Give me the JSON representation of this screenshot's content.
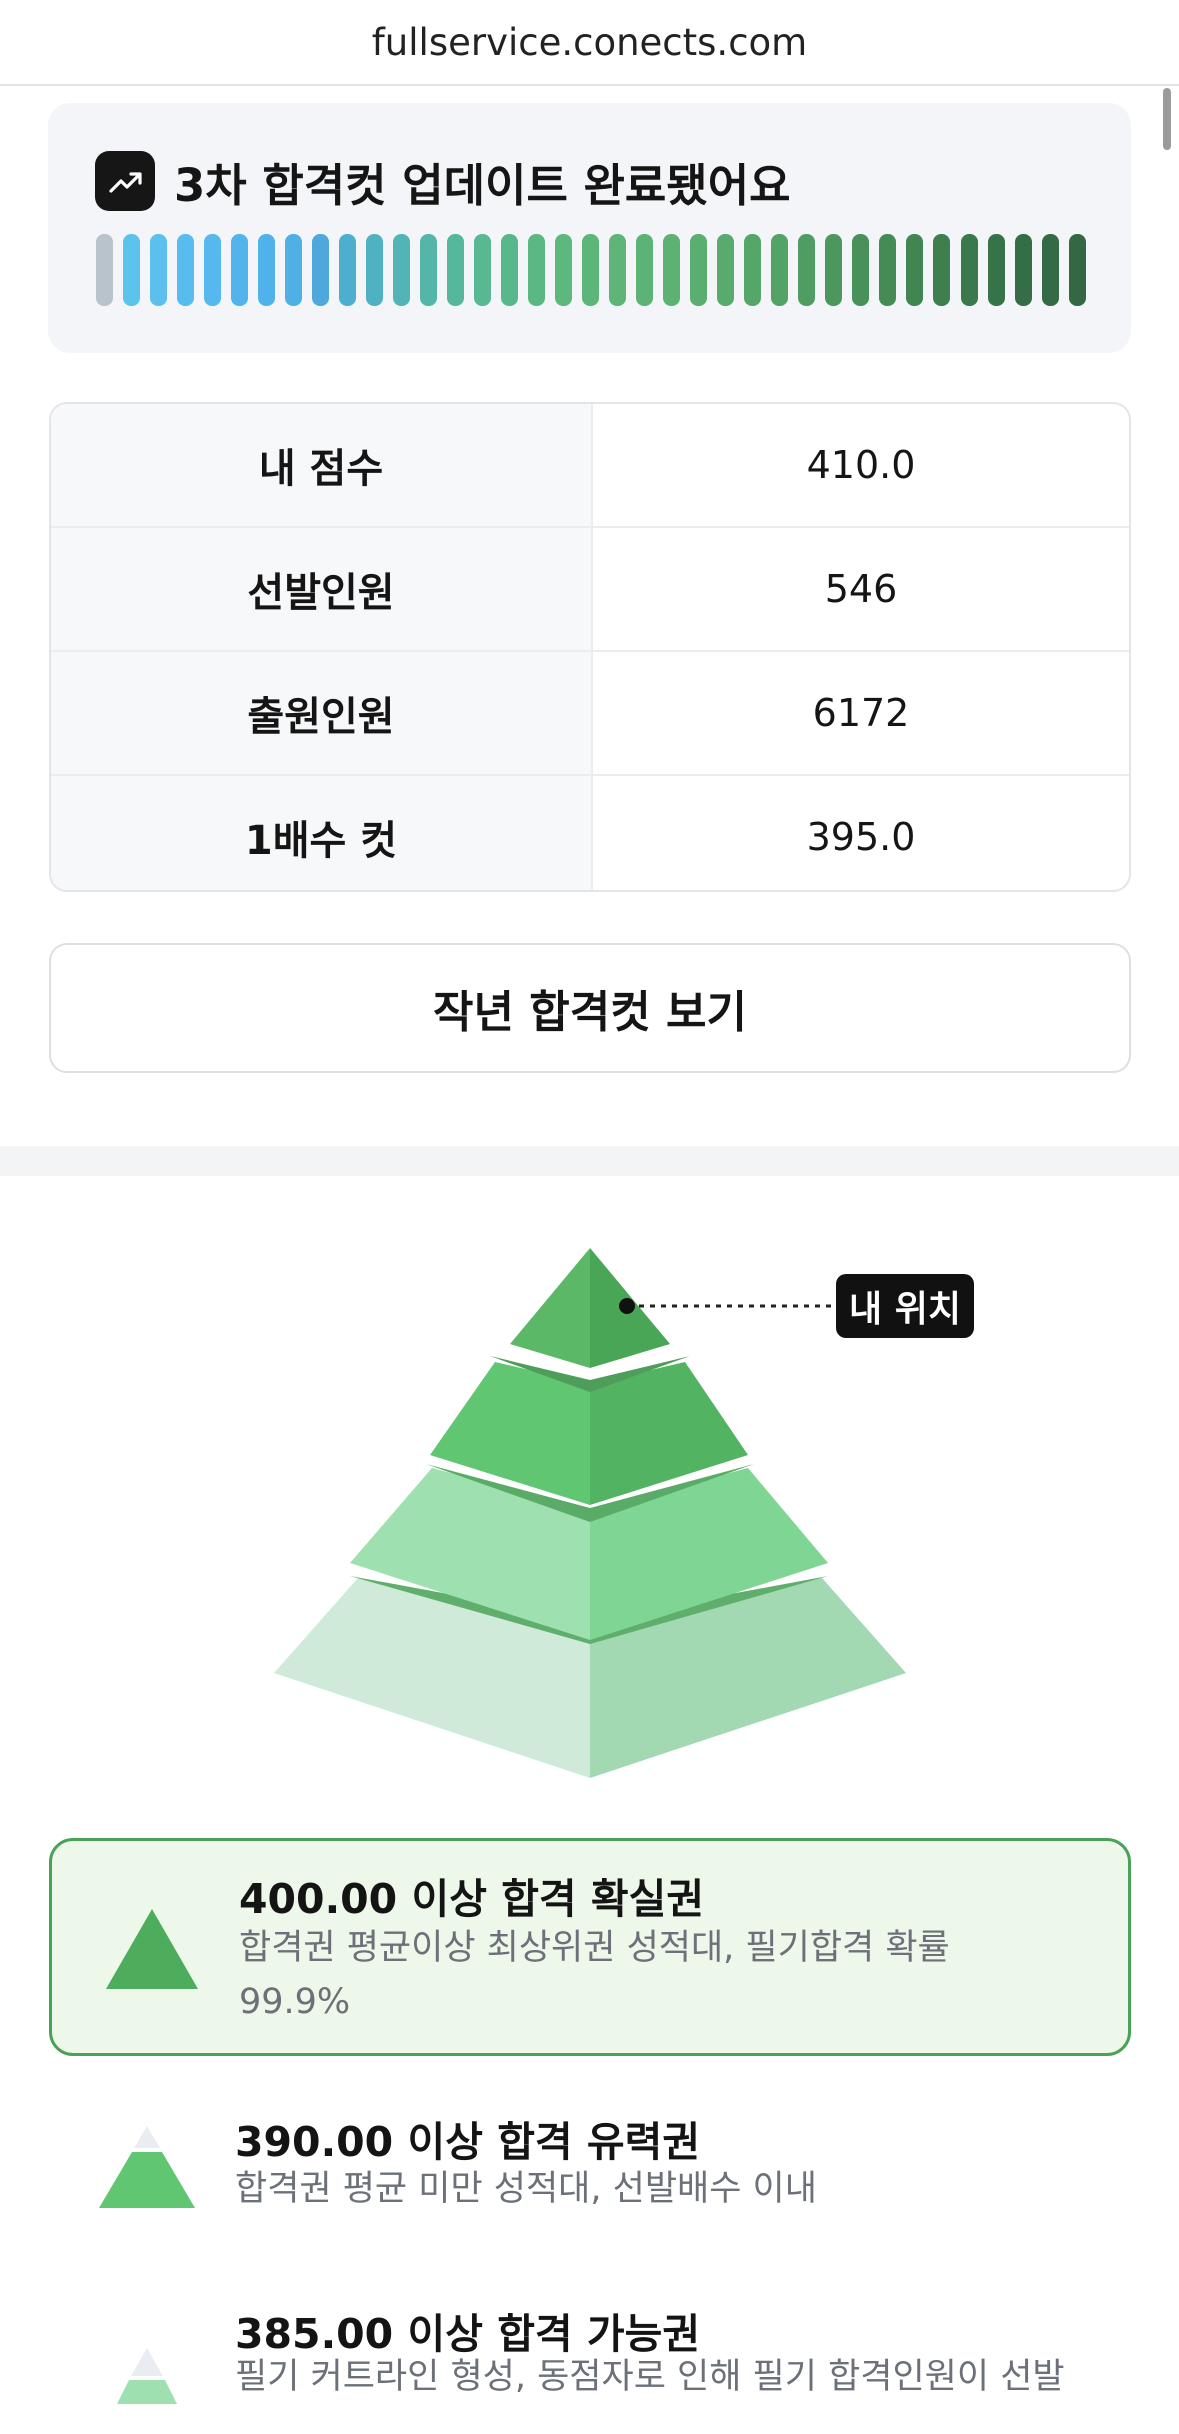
{
  "browser": {
    "url": "fullservice.conects.com"
  },
  "banner": {
    "icon": "trending-up-icon",
    "title": "3차 합격컷 업데이트 완료됐어요",
    "progress_colors": [
      "#b9c3cc",
      "#5cc3ec",
      "#5cc0ee",
      "#58bcef",
      "#55b8ee",
      "#52b4ec",
      "#50b2ea",
      "#4fb0e6",
      "#4ea8dc",
      "#4eaecf",
      "#4fb2c2",
      "#51b5b5",
      "#53b6a8",
      "#55b79c",
      "#57b892",
      "#59b889",
      "#5bb882",
      "#5cb87d",
      "#5db679",
      "#5db577",
      "#5db375",
      "#5cb173",
      "#5aae70",
      "#58aa6d",
      "#56a66a",
      "#53a266",
      "#4f9d62",
      "#4b975e",
      "#48915a",
      "#448b56",
      "#418552",
      "#3d7f4e",
      "#3a794b",
      "#377348",
      "#356e46",
      "#346a45",
      "#346844"
    ]
  },
  "stats": [
    {
      "label": "내 점수",
      "value": "410.0"
    },
    {
      "label": "선발인원",
      "value": "546"
    },
    {
      "label": "출원인원",
      "value": "6172"
    },
    {
      "label": "1배수 컷",
      "value": "395.0"
    }
  ],
  "last_year_button": {
    "label": "작년 합격컷 보기"
  },
  "pyramid": {
    "my_position_label": "내 위치"
  },
  "tiers": [
    {
      "title": "400.00 이상 합격 확실권",
      "desc": "합격권 평균이상 최상위권 성적대, 필기합격 확률 99.9%",
      "active": true
    },
    {
      "title": "390.00 이상 합격 유력권",
      "desc": "합격권 평균 미만 성적대, 선발배수 이내",
      "active": false
    },
    {
      "title": "385.00 이상 합격 가능권",
      "desc": "필기 커트라인 형성, 동점자로 인해 필기 합격인원이 선발",
      "active": false
    }
  ]
}
